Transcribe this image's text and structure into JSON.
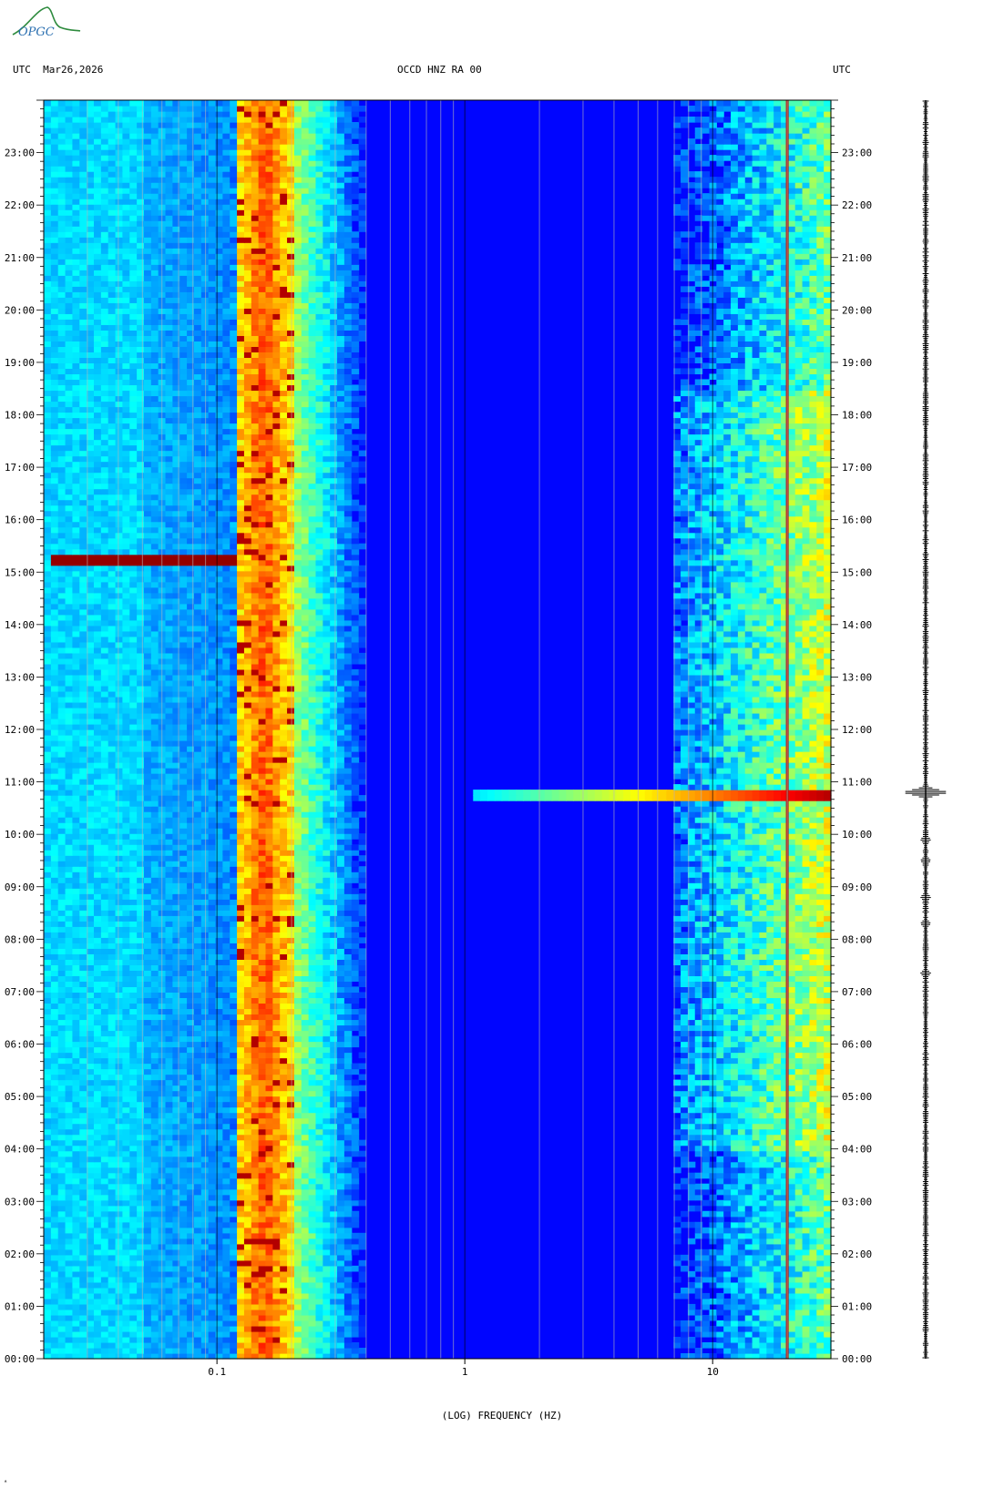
{
  "header": {
    "left_tz": "UTC",
    "date": "Mar26,2026",
    "station": "OCCD HNZ RA 00",
    "right_tz": "UTC"
  },
  "logo": {
    "text": "OPGC"
  },
  "chart_data": {
    "type": "heatmap",
    "xlabel": "(LOG) FREQUENCY (HZ)",
    "xscale": "log",
    "xlim": [
      0.02,
      30
    ],
    "x_ticks": [
      {
        "value": 0.1,
        "label": "0.1"
      },
      {
        "value": 1,
        "label": "1"
      },
      {
        "value": 10,
        "label": "10"
      }
    ],
    "ylim_hours": [
      0,
      24
    ],
    "y_ticks": [
      "00:00",
      "01:00",
      "02:00",
      "03:00",
      "04:00",
      "05:00",
      "06:00",
      "07:00",
      "08:00",
      "09:00",
      "10:00",
      "11:00",
      "12:00",
      "13:00",
      "14:00",
      "15:00",
      "16:00",
      "17:00",
      "18:00",
      "19:00",
      "20:00",
      "21:00",
      "22:00",
      "23:00"
    ],
    "colormap": "jet",
    "features": [
      {
        "kind": "microseism-band",
        "f_min": 0.12,
        "f_max": 0.2
      },
      {
        "kind": "persistent-line",
        "freq": 20
      },
      {
        "kind": "cultural-noise-band",
        "f_min": 7,
        "f_max": 30
      },
      {
        "kind": "event",
        "time_hours": 10.75,
        "f_min": 1.1,
        "f_max": 30
      },
      {
        "kind": "long-period-streak",
        "time_hours": 15.25,
        "f_min": 0.022,
        "f_max": 0.12
      }
    ],
    "trace_events_hours": [
      10.8,
      9.9,
      9.5,
      8.8,
      8.3,
      7.35
    ]
  }
}
